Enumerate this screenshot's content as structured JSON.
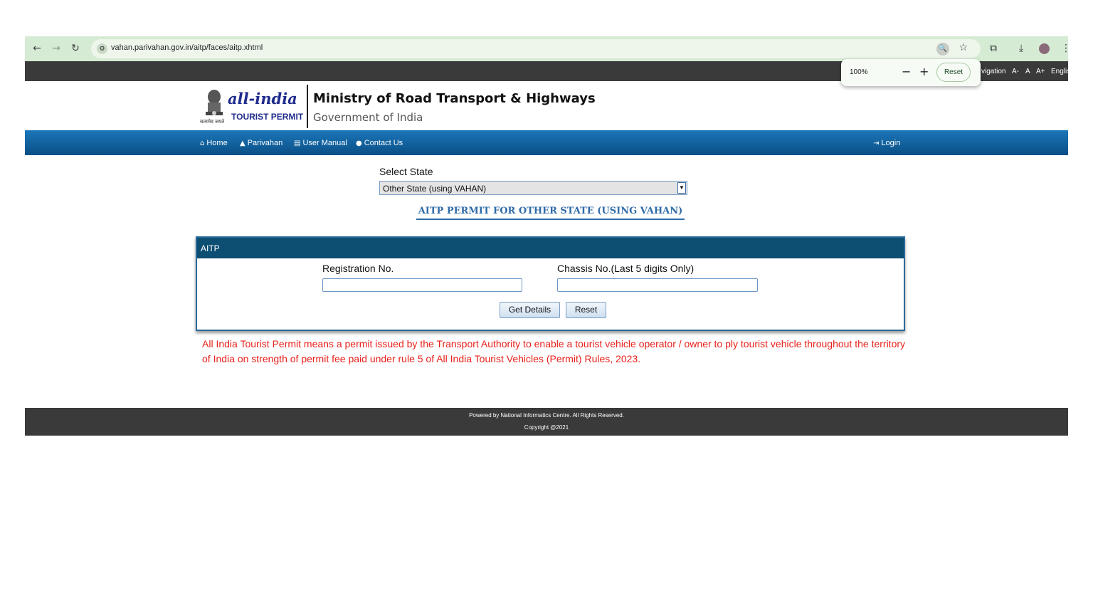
{
  "browser": {
    "url": "vahan.parivahan.gov.in/aitp/faces/aitp.xhtml",
    "zoom_popup": {
      "value": "100%",
      "minus": "−",
      "plus": "+",
      "reset_label": "Reset"
    }
  },
  "a11y_bar": {
    "nav_text": "vigation",
    "font_small": "A-",
    "font_normal": "A",
    "font_large": "A+",
    "language": "Englis"
  },
  "header": {
    "logo_main": "all-india",
    "logo_sub": "TOURIST PERMIT",
    "motto": "सत्यमेव जयते",
    "title": "Ministry of Road Transport & Highways",
    "subtitle": "Government of India"
  },
  "nav": {
    "home": "Home",
    "parivahan": "Parivahan",
    "user_manual": "User Manual",
    "contact": "Contact Us",
    "login": "Login"
  },
  "state": {
    "label": "Select State",
    "selected": "Other State (using VAHAN)"
  },
  "permit_heading": "AITP PERMIT FOR OTHER STATE (USING VAHAN)",
  "panel": {
    "title": "AITP",
    "reg_label": "Registration No.",
    "reg_value": "",
    "chassis_label": "Chassis No.(Last 5 digits Only)",
    "chassis_value": "",
    "get_details": "Get Details",
    "reset": "Reset"
  },
  "info_text": "All India Tourist Permit means a permit issued by the Transport Authority to enable a tourist vehicle operator / owner to ply tourist vehicle throughout the territory of India on strength of permit fee paid under rule 5 of All India Tourist Vehicles (Permit) Rules, 2023.",
  "footer": {
    "line1": "Powered by National Informatics Centre. All Rights Reserved.",
    "line2": "Copyright @2021"
  },
  "colors": {
    "nav_blue": "#0a4f86",
    "panel_head": "#0d4e73",
    "info_red": "#e8211b",
    "heading_blue": "#2f6aa7"
  }
}
